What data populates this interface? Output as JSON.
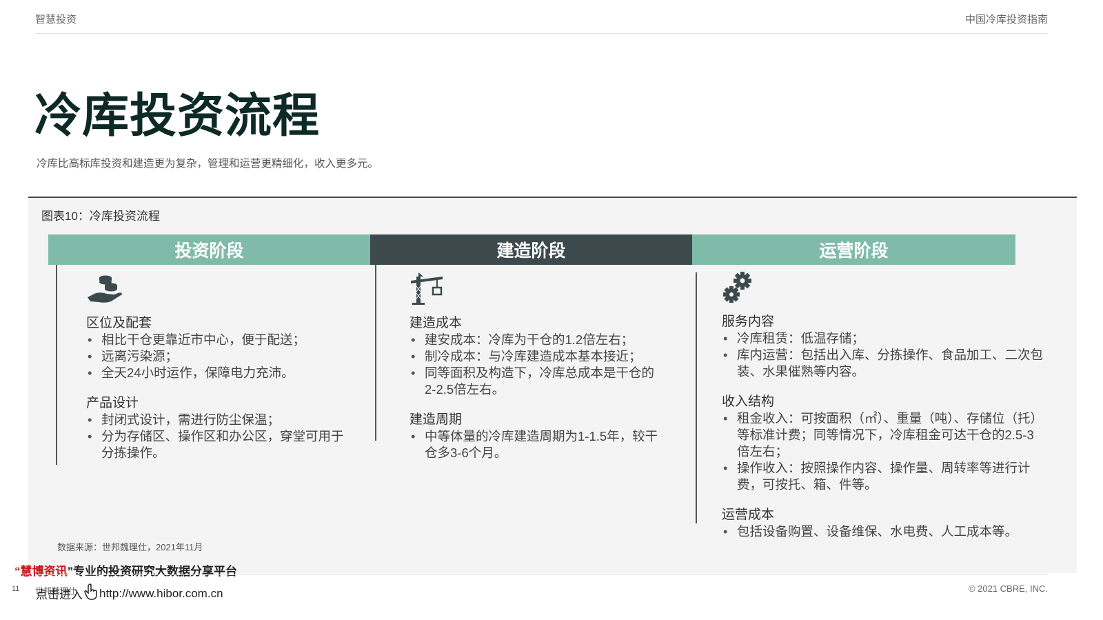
{
  "header": {
    "left": "智慧投资",
    "right": "中国冷库投资指南"
  },
  "title": "冷库投资流程",
  "subtitle": "冷库比高标库投资和建造更为复杂，管理和运营更精细化，收入更多元。",
  "figure": {
    "title": "图表10：冷库投资流程",
    "stages": [
      {
        "label": "投资阶段",
        "icon": "hand-coins-icon",
        "sections": [
          {
            "title": "区位及配套",
            "items": [
              "相比干仓更靠近市中心，便于配送；",
              "远离污染源；",
              "全天24小时运作，保障电力充沛。"
            ]
          },
          {
            "title": "产品设计",
            "items": [
              "封闭式设计，需进行防尘保温；",
              "分为存储区、操作区和办公区，穿堂可用于分拣操作。"
            ]
          }
        ]
      },
      {
        "label": "建造阶段",
        "icon": "crane-icon",
        "sections": [
          {
            "title": "建造成本",
            "items": [
              "建安成本：冷库为干仓的1.2倍左右；",
              "制冷成本：与冷库建造成本基本接近；",
              "同等面积及构造下，冷库总成本是干仓的2-2.5倍左右。"
            ]
          },
          {
            "title": "建造周期",
            "items": [
              "中等体量的冷库建造周期为1-1.5年，较干仓多3-6个月。"
            ]
          }
        ]
      },
      {
        "label": "运营阶段",
        "icon": "gears-icon",
        "sections": [
          {
            "title": "服务内容",
            "items": [
              "冷库租赁：低温存储；",
              "库内运营：包括出入库、分拣操作、食品加工、二次包装、水果催熟等内容。"
            ]
          },
          {
            "title": "收入结构",
            "items": [
              "租金收入：可按面积（㎡）、重量（吨）、存储位（托）等标准计费；同等情况下，冷库租金可达干仓的2.5-3倍左右；",
              "操作收入：按照操作内容、操作量、周转率等进行计费，可按托、箱、件等。"
            ]
          },
          {
            "title": "运营成本",
            "items": [
              "包括设备购置、设备维保、水电费、人工成本等。"
            ]
          }
        ]
      }
    ],
    "source": "数据来源：世邦魏理仕，2021年11月"
  },
  "watermark": {
    "quote_open": "“",
    "brand": "慧博资讯",
    "quote_close": "”",
    "tagline": "专业的投资研究大数据分享平台",
    "enter": "点击进入",
    "url": "http://www.hibor.com.cn"
  },
  "footer": {
    "page_number": "11",
    "company": "世邦魏理仕",
    "copyright": "© 2021 CBRE, INC."
  },
  "colors": {
    "teal": "#7fbba8",
    "dark": "#3d4a4d",
    "title": "#0e2a26",
    "brand_red": "#c8141a"
  }
}
